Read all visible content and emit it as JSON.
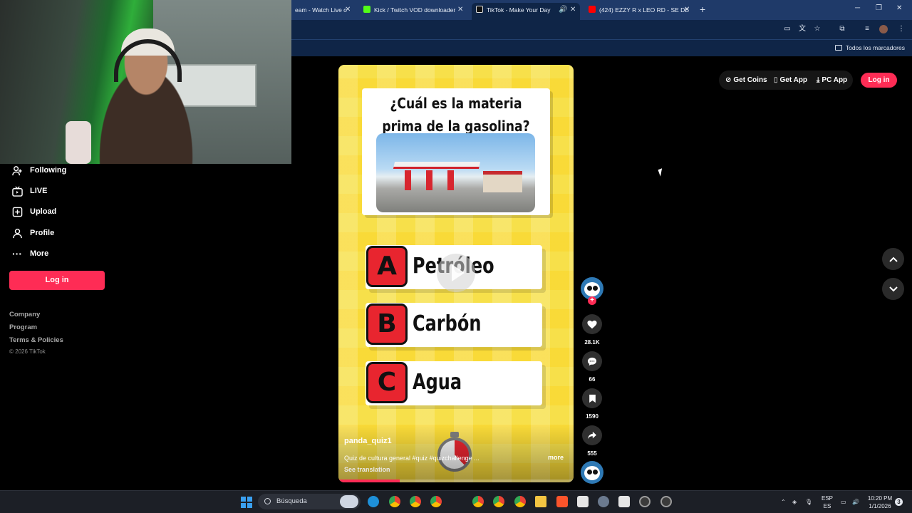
{
  "browser": {
    "tabs": [
      {
        "title": "eam - Watch Live o",
        "favicon_color": "#9146ff",
        "active": false
      },
      {
        "title": "Kick / Twitch VOD downloader",
        "favicon_color": "#53fc18",
        "active": false
      },
      {
        "title": "TikTok - Make Your Day",
        "favicon_color": "#ffffff",
        "active": true
      },
      {
        "title": "(424) EZZY R x LEO RD - SE DE",
        "favicon_color": "#ff0000",
        "active": false
      }
    ],
    "new_tab_icon": "+",
    "bookmarks_all": "Todos los marcadores"
  },
  "sidebar": {
    "items": [
      {
        "label": "Following",
        "icon": "following-icon"
      },
      {
        "label": "LIVE",
        "icon": "live-icon"
      },
      {
        "label": "Upload",
        "icon": "upload-icon"
      },
      {
        "label": "Profile",
        "icon": "profile-icon"
      },
      {
        "label": "More",
        "icon": "more-icon"
      }
    ],
    "login_label": "Log in",
    "footer": [
      "Company",
      "Program",
      "Terms & Policies"
    ],
    "copyright": "© 2026 TikTok"
  },
  "header": {
    "get_coins": "Get Coins",
    "get_app": "Get App",
    "pc_app": "PC App",
    "login": "Log in"
  },
  "video": {
    "question": "¿Cuál es la materia prima de la gasolina?",
    "answers": [
      {
        "letter": "A",
        "text": "Petróleo"
      },
      {
        "letter": "B",
        "text": "Carbón"
      },
      {
        "letter": "C",
        "text": "Agua"
      }
    ],
    "author": "panda_quiz1",
    "description": "Quiz de cultura general #quiz #quizchallenge ...",
    "more": "more",
    "see_translation": "See translation",
    "progress": 0.26
  },
  "actions": {
    "likes": "28.1K",
    "comments": "66",
    "saves": "1590",
    "shares": "555"
  },
  "taskbar": {
    "search_label": "Búsqueda",
    "lang_top": "ESP",
    "lang_bottom": "ES",
    "time": "10:20 PM",
    "date": "1/1/2026",
    "notifications": "3"
  },
  "colors": {
    "accent": "#fe2c55",
    "chrome": "#0f2547",
    "quiz_bg": "#f7e04a",
    "answer_letter": "#e8252f"
  }
}
